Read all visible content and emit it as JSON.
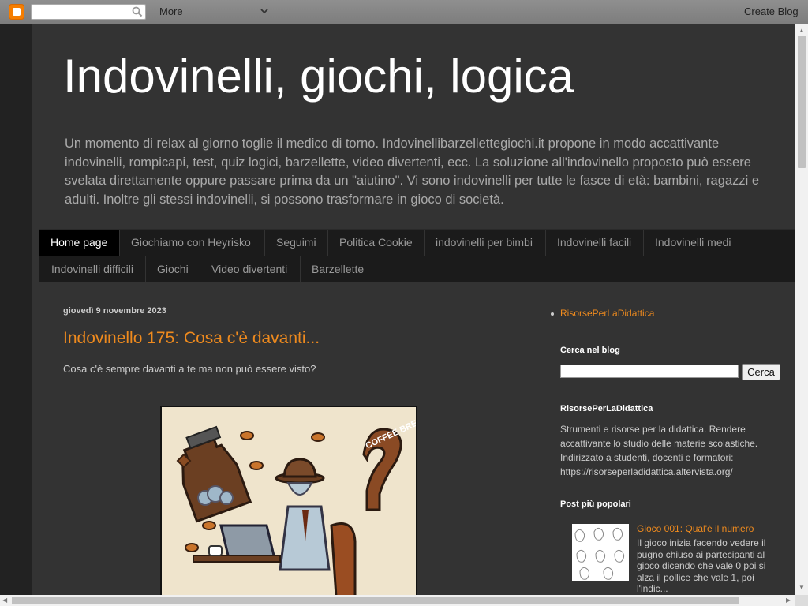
{
  "navbar": {
    "more_label": "More",
    "create_blog_label": "Create Blog"
  },
  "header": {
    "title": "Indovinelli, giochi, logica",
    "description": "Un momento di relax al giorno toglie il medico di torno. Indovinellibarzellettegiochi.it propone in modo accattivante indovinelli, rompicapi, test, quiz logici, barzellette, video divertenti, ecc. La soluzione all'indovinello proposto può essere svelata direttamente oppure passare prima da un \"aiutino\". Vi sono indovinelli per tutte le fasce di età: bambini, ragazzi e adulti. Inoltre gli stessi indovinelli, si possono trasformare in gioco di società."
  },
  "tabs": [
    "Home page",
    "Giochiamo con Heyrisko",
    "Seguimi",
    "Politica Cookie",
    "indovinelli per bimbi",
    "Indovinelli facili",
    "Indovinelli medi",
    "Indovinelli difficili",
    "Giochi",
    "Video divertenti",
    "Barzellette"
  ],
  "post": {
    "date": "giovedì 9 novembre 2023",
    "title": "Indovinello 175: Cosa c'è davanti...",
    "body": "Cosa c'è sempre davanti a te ma non può essere visto?",
    "image_badge_text": "COFFEE BREAK"
  },
  "sidebar": {
    "link_item": "RisorsePerLaDidattica",
    "search_heading": "Cerca nel blog",
    "search_button": "Cerca",
    "about_heading": "RisorsePerLaDidattica",
    "about_text": "Strumenti e risorse per la didattica. Rendere accattivante lo studio delle materie scolastiche. Indirizzato a studenti, docenti e formatori: https://risorseperladidattica.altervista.org/",
    "popular_heading": "Post più popolari",
    "popular_title": "Gioco 001: Qual'è il numero",
    "popular_snippet": "Il gioco inizia facendo vedere il pugno chiuso ai partecipanti al gioco  dicendo che vale 0 poi si alza il pollice che vale 1, poi l'indic..."
  },
  "colors": {
    "accent": "#ee8a1e",
    "background": "#333333"
  }
}
